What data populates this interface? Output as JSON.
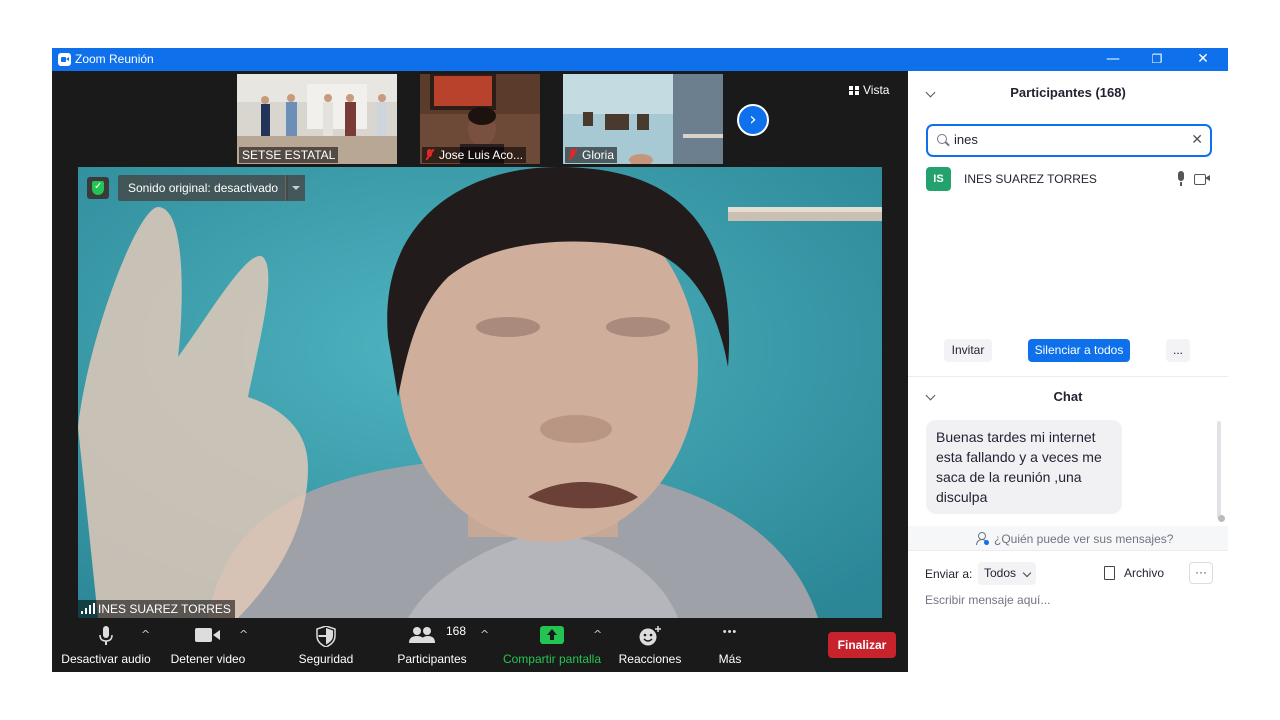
{
  "window": {
    "title": "Zoom Reunión",
    "minimize": "—",
    "restore": "❐",
    "close": "✕"
  },
  "thumbnails": [
    {
      "name": "SETSE ESTATAL",
      "muted": false
    },
    {
      "name": "Jose Luis Aco...",
      "muted": true
    },
    {
      "name": "Gloria",
      "muted": true
    }
  ],
  "thumb_next": "›",
  "view_button": "Vista",
  "main_video": {
    "sound_label": "Sonido original: desactivado",
    "speaker": "INES SUAREZ TORRES"
  },
  "toolbar": {
    "mute": "Desactivar audio",
    "video": "Detener video",
    "security": "Seguridad",
    "participants": "Participantes",
    "participants_count": "168",
    "share": "Compartir pantalla",
    "reactions": "Reacciones",
    "more": "Más",
    "more_glyph": "•••",
    "caret": "^",
    "end": "Finalizar"
  },
  "participants_panel": {
    "title": "Participantes (168)",
    "search_value": "ines",
    "clear": "✕",
    "list": [
      {
        "initials": "IS",
        "name": "INES SUAREZ TORRES"
      }
    ],
    "invite": "Invitar",
    "mute_all": "Silenciar a todos",
    "more": "..."
  },
  "chat_panel": {
    "title": "Chat",
    "messages": [
      {
        "text": "Buenas tardes mi internet esta fallando y a veces me saca de la reunión ,una disculpa"
      }
    ],
    "who_can_see": "¿Quién puede ver sus mensajes?",
    "send_to_label": "Enviar a:",
    "send_to_value": "Todos",
    "file": "Archivo",
    "more": "···",
    "input_placeholder": "Escribir mensaje aquí..."
  },
  "colors": {
    "titlebar": "#0e71eb",
    "end_button": "#c8232c",
    "share_green": "#23c552",
    "avatar_green": "#23a26d",
    "accent_blue": "#0e71eb"
  }
}
